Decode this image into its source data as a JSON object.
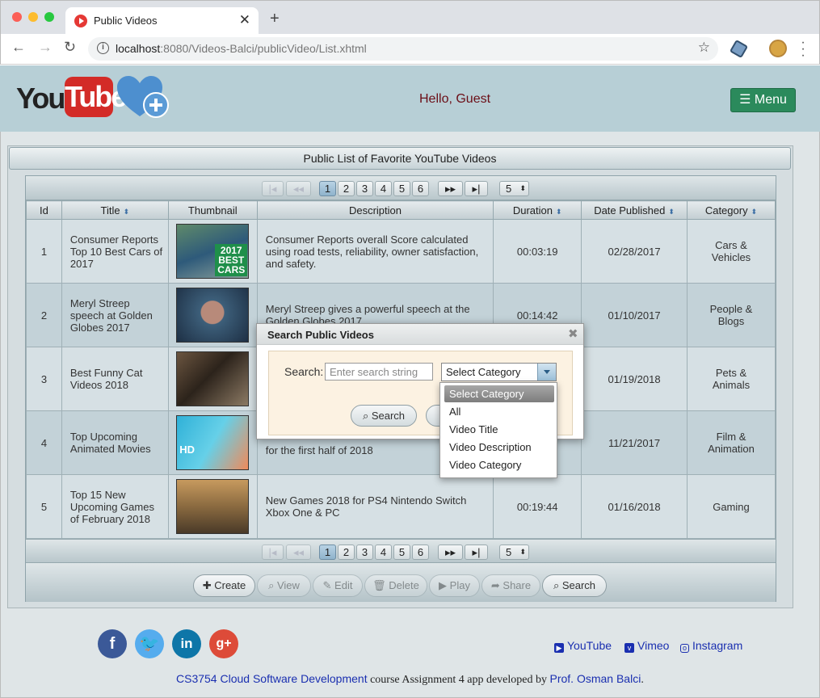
{
  "browser": {
    "tab_title": "Public Videos",
    "url_host": "localhost",
    "url_rest": ":8080/Videos-Balci/publicVideo/List.xhtml"
  },
  "header": {
    "logo_you": "You",
    "logo_tube": "Tube",
    "greeting": "Hello, Guest",
    "menu_label": "☰ Menu"
  },
  "panel": {
    "title": "Public List of Favorite YouTube Videos",
    "pager": {
      "first": "|◂",
      "prev": "◂◂",
      "pages": [
        "1",
        "2",
        "3",
        "4",
        "5",
        "6"
      ],
      "next": "▸▸",
      "last": "▸|",
      "rows_per_page": "5"
    },
    "columns": [
      "Id",
      "Title",
      "Thumbnail",
      "Description",
      "Duration",
      "Date Published",
      "Category"
    ],
    "rows": [
      {
        "id": "1",
        "title": "Consumer Reports Top 10 Best Cars of 2017",
        "description": "Consumer Reports overall Score calculated using road tests, reliability, owner satisfaction, and safety.",
        "duration": "00:03:19",
        "date": "02/28/2017",
        "category": "Cars & Vehicles",
        "thumb_text": "2017 BEST CARS"
      },
      {
        "id": "2",
        "title": "Meryl Streep speech at Golden Globes 2017",
        "description": "Meryl Streep gives a powerful speech at the Golden Globes 2017",
        "duration": "00:14:42",
        "date": "01/10/2017",
        "category": "People & Blogs",
        "thumb_text": ""
      },
      {
        "id": "3",
        "title": "Best Funny Cat Videos 2018",
        "description": "",
        "duration": "",
        "date": "01/19/2018",
        "category": "Pets & Animals",
        "thumb_text": ""
      },
      {
        "id": "4",
        "title": "Top Upcoming Animated Movies",
        "description": "for the first half of 2018",
        "duration": "",
        "date": "11/21/2017",
        "category": "Film & Animation",
        "thumb_text": "HD"
      },
      {
        "id": "5",
        "title": "Top 15 New Upcoming Games of February 2018",
        "description": "New Games 2018 for PS4 Nintendo Switch Xbox One & PC",
        "duration": "00:19:44",
        "date": "01/16/2018",
        "category": "Gaming",
        "thumb_text": ""
      }
    ],
    "actions": {
      "create": "Create",
      "view": "View",
      "edit": "Edit",
      "delete": "Delete",
      "play": "Play",
      "share": "Share",
      "search": "Search"
    }
  },
  "dialog": {
    "title": "Search Public Videos",
    "search_label": "Search:",
    "search_placeholder": "Enter search string",
    "category_value": "Select Category",
    "search_button": "Search",
    "options": [
      "Select Category",
      "All",
      "Video Title",
      "Video Description",
      "Video Category"
    ]
  },
  "footer": {
    "links": [
      "YouTube",
      "Vimeo",
      "Instagram"
    ],
    "credit_course": "CS3754 Cloud Software Development",
    "credit_middle": " course Assignment 4 app developed by ",
    "credit_author": "Prof. Osman Balci",
    "credit_end": "."
  },
  "colors": {
    "header_bg": "#b7cfd6",
    "menu_green": "#2b8a5c",
    "greeting_color": "#6b0e17",
    "link_blue": "#1a2fb0"
  }
}
